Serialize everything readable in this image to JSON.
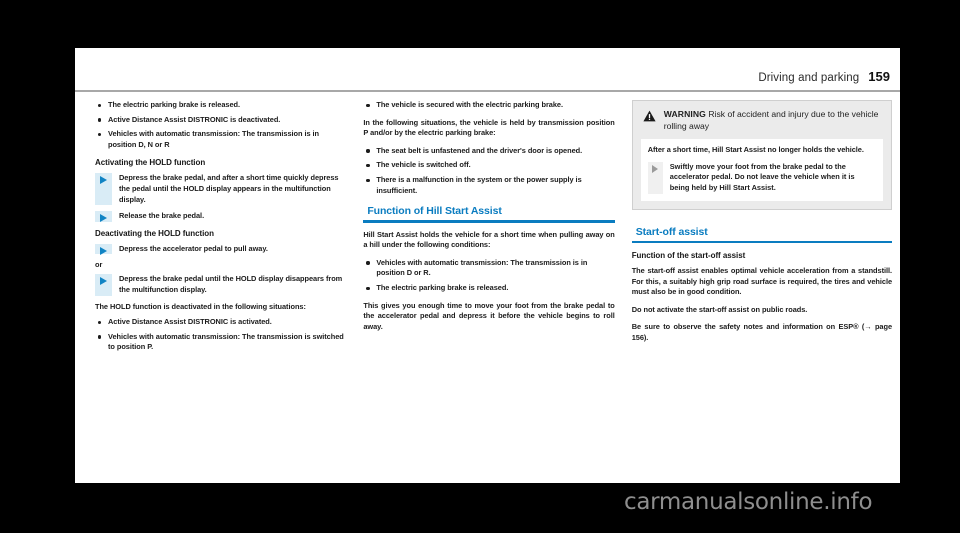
{
  "header": {
    "section_title": "Driving and parking",
    "page_number": "159"
  },
  "column1": {
    "hold_conditions": [
      "The electric parking brake is released.",
      "Active Distance Assist DISTRONIC is deactivated.",
      "Vehicles with automatic transmission: The transmission is in position D, N or R"
    ],
    "activating_heading": "Activating the HOLD function",
    "activating_steps": [
      "Depress the brake pedal, and after a short time quickly depress the pedal until the HOLD display appears in the multifunction display.",
      "Release the brake pedal."
    ],
    "deactivating_heading": "Deactivating the HOLD function",
    "deactivating_step_1": "Depress the accelerator pedal to pull away.",
    "or_label": "or",
    "deactivating_step_2": "Depress the brake pedal until the HOLD display disappears from the multifunction display.",
    "deactivated_intro": "The HOLD function is deactivated in the following situations:",
    "deactivated_list": [
      "Active Distance Assist DISTRONIC is activated.",
      "Vehicles with automatic transmission: The transmission is switched to position P."
    ]
  },
  "column2": {
    "secured_bullet": "The vehicle is secured with the electric parking brake.",
    "held_intro": "In the following situations, the vehicle is held by transmission position P and/or by the electric parking brake:",
    "held_list": [
      "The seat belt is unfastened and the driver's door is opened.",
      "The vehicle is switched off.",
      "There is a malfunction in the system or the power supply is insufficient."
    ],
    "section_heading": "Function of Hill Start Assist",
    "hsa_intro": "Hill Start Assist holds the vehicle for a short time when pulling away on a hill under the following conditions:",
    "hsa_list": [
      "Vehicles with automatic transmission: The transmission is in position D or R.",
      "The electric parking brake is released."
    ],
    "hsa_outro": "This gives you enough time to move your foot from the brake pedal to the accelerator pedal and depress it before the vehicle begins to roll away."
  },
  "column3": {
    "warning": {
      "label": "WARNING",
      "title_rest": " Risk of accident and injury due to the vehicle rolling away",
      "body_text": "After a short time, Hill Start Assist no longer holds the vehicle.",
      "step_text": "Swiftly move your foot from the brake pedal to the accelerator pedal. Do not leave the vehicle when it is being held by Hill Start Assist."
    },
    "section_heading": "Start-off assist",
    "subheading": "Function of the start-off assist",
    "para_1": "The start-off assist enables optimal vehicle acceleration from a standstill. For this, a suitably high grip road surface is required, the tires and vehicle must also be in good condition.",
    "para_2": "Do not activate the start-off assist on public roads.",
    "para_3": "Be sure to observe the safety notes and information on ESP® (→ page 156)."
  },
  "watermark": {
    "text": "carmanualsonline.info"
  },
  "colors": {
    "accent_blue": "#0a7cc0",
    "step_bar": "#d9ecf6",
    "warn_bg": "#ebebeb",
    "page_bg": "#ffffff",
    "frame": "#000000"
  }
}
